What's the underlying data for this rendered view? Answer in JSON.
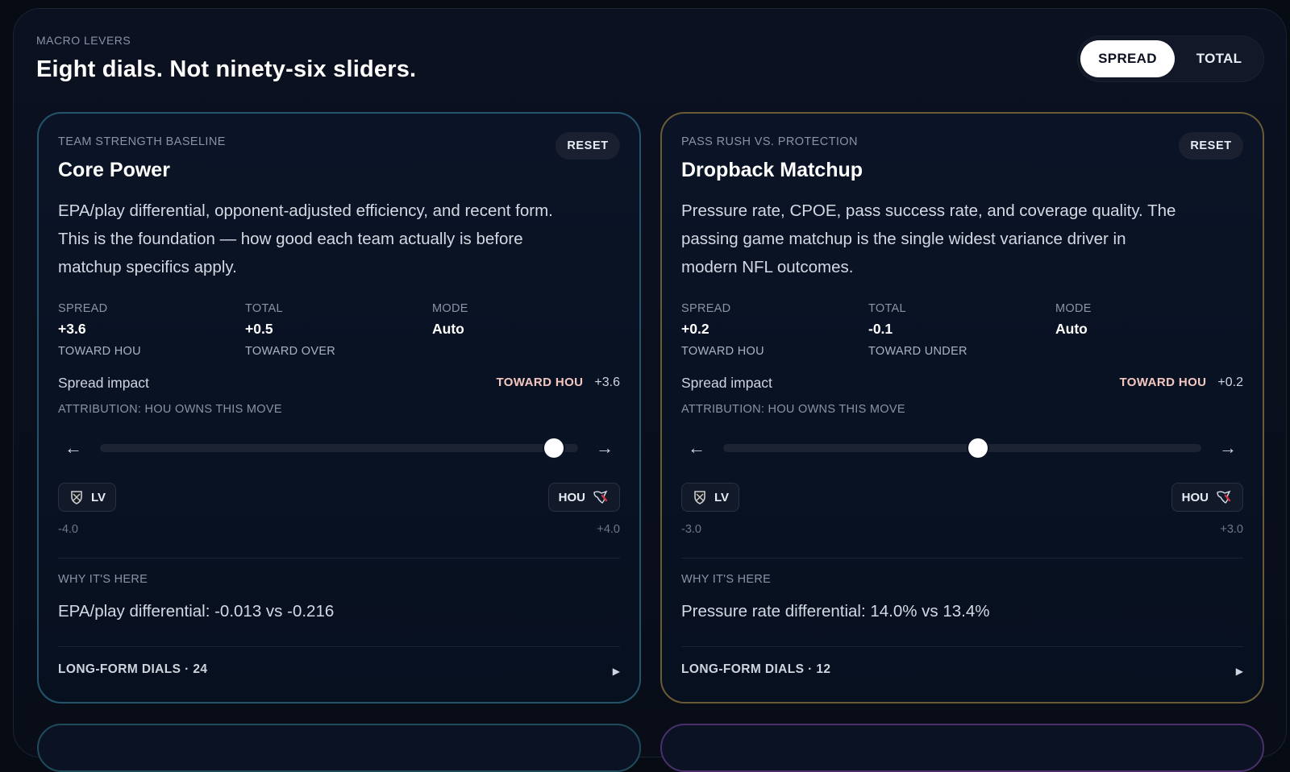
{
  "header": {
    "eyebrow": "MACRO LEVERS",
    "title": "Eight dials. Not ninety-six sliders."
  },
  "toggle": {
    "options": [
      "SPREAD",
      "TOTAL"
    ],
    "active": "SPREAD"
  },
  "colors": {
    "card1_border": "#24546a",
    "card2_border": "#6a5a36",
    "impact_accent": "#f4c7c1"
  },
  "cards": [
    {
      "category": "TEAM STRENGTH BASELINE",
      "reset_label": "RESET",
      "title": "Core Power",
      "description": "EPA/play differential, opponent-adjusted efficiency, and recent form. This is the foundation — how good each team actually is before matchup specifics apply.",
      "stats": [
        {
          "label": "SPREAD",
          "value": "+3.6",
          "sub": "TOWARD HOU"
        },
        {
          "label": "TOTAL",
          "value": "+0.5",
          "sub": "TOWARD OVER"
        },
        {
          "label": "MODE",
          "value": "Auto",
          "sub": ""
        }
      ],
      "impact_label": "Spread impact",
      "impact_toward": "TOWARD HOU",
      "impact_value": "+3.6",
      "attribution": "ATTRIBUTION: HOU OWNS THIS MOVE",
      "slider": {
        "min": -4.0,
        "max": 4.0,
        "value": 3.6
      },
      "left_team": {
        "abbr": "LV",
        "icon": "raiders-shield-icon"
      },
      "right_team": {
        "abbr": "HOU",
        "icon": "texans-bull-icon"
      },
      "range_min_label": "-4.0",
      "range_max_label": "+4.0",
      "why_label": "WHY IT'S HERE",
      "why_text": "EPA/play differential: -0.013 vs -0.216",
      "longform_label": "LONG-FORM DIALS · 24"
    },
    {
      "category": "PASS RUSH VS. PROTECTION",
      "reset_label": "RESET",
      "title": "Dropback Matchup",
      "description": "Pressure rate, CPOE, pass success rate, and coverage quality. The passing game matchup is the single widest variance driver in modern NFL outcomes.",
      "stats": [
        {
          "label": "SPREAD",
          "value": "+0.2",
          "sub": "TOWARD HOU"
        },
        {
          "label": "TOTAL",
          "value": "-0.1",
          "sub": "TOWARD UNDER"
        },
        {
          "label": "MODE",
          "value": "Auto",
          "sub": ""
        }
      ],
      "impact_label": "Spread impact",
      "impact_toward": "TOWARD HOU",
      "impact_value": "+0.2",
      "attribution": "ATTRIBUTION: HOU OWNS THIS MOVE",
      "slider": {
        "min": -3.0,
        "max": 3.0,
        "value": 0.2
      },
      "left_team": {
        "abbr": "LV",
        "icon": "raiders-shield-icon"
      },
      "right_team": {
        "abbr": "HOU",
        "icon": "texans-bull-icon"
      },
      "range_min_label": "-3.0",
      "range_max_label": "+3.0",
      "why_label": "WHY IT'S HERE",
      "why_text": "Pressure rate differential: 14.0% vs 13.4%",
      "longform_label": "LONG-FORM DIALS · 12"
    }
  ]
}
